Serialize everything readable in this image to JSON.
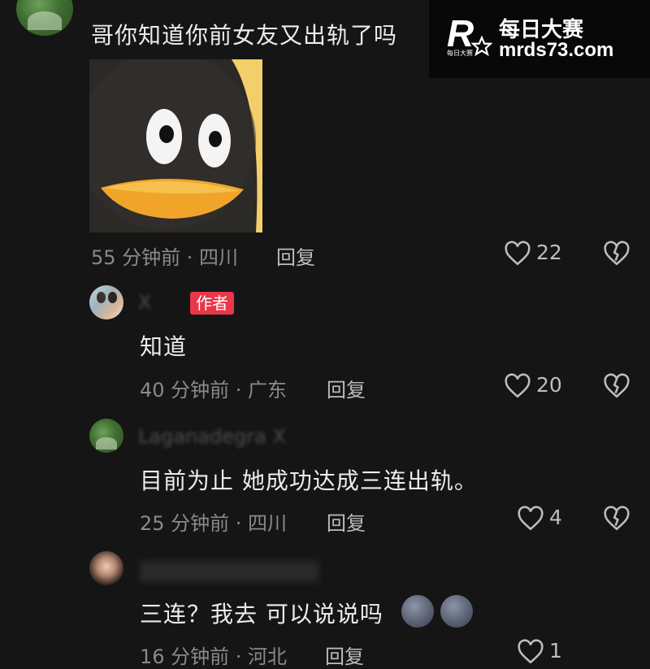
{
  "watermark": {
    "logo_letter": "R",
    "logo_small": "每日大赛",
    "title": "每日大赛",
    "url": "mrds73.com"
  },
  "comments": [
    {
      "text": "哥你知道你前女友又出轨了吗",
      "meta": "55 分钟前 · 四川",
      "reply": "回复",
      "likes": "22",
      "sticker": "penguin-sticker"
    },
    {
      "name": "X",
      "badge": "作者",
      "text": "知道",
      "meta": "40 分钟前 · 广东",
      "reply": "回复",
      "likes": "20"
    },
    {
      "name": "Laganadegra X",
      "text": "目前为止 她成功达成三连出轨。",
      "meta": "25 分钟前 · 四川",
      "reply": "回复",
      "likes": "4"
    },
    {
      "name": "",
      "text": "三连？我去 可以说说吗",
      "meta": "16 分钟前 · 河北",
      "reply": "回复",
      "likes": "1"
    }
  ],
  "icons": {
    "like": "heart-outline-icon",
    "dislike": "broken-heart-icon",
    "emoji": "moon-face-emoji"
  }
}
